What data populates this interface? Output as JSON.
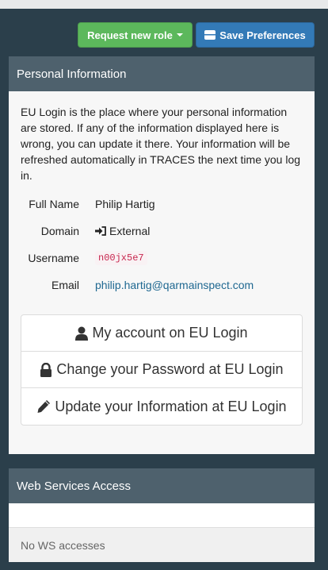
{
  "toolbar": {
    "request_role_label": "Request new role",
    "save_preferences_label": "Save Preferences",
    "request_role_color": "#5cb85c",
    "save_preferences_color": "#337ab7"
  },
  "personal": {
    "title": "Personal Information",
    "intro": "EU Login is the place where your personal information are stored. If any of the information displayed here is wrong, you can update it there. Your information will be refreshed automatically in TRACES the next time you log in.",
    "fields": [
      {
        "label": "Full Name",
        "value": "Philip Hartig"
      },
      {
        "label": "Domain",
        "value": "External",
        "icon": "sign-in-icon"
      },
      {
        "label": "Username",
        "value": "n00jx5e7"
      },
      {
        "label": "Email",
        "value": "philip.hartig@qarmainspect.com"
      }
    ],
    "actions": [
      {
        "label": "My account on EU Login",
        "icon": "user-icon"
      },
      {
        "label": "Change your Password at EU Login",
        "icon": "lock-icon"
      },
      {
        "label": "Update your Information at EU Login",
        "icon": "pencil-icon"
      }
    ]
  },
  "ws": {
    "title": "Web Services Access",
    "empty_text": "No WS accesses"
  }
}
